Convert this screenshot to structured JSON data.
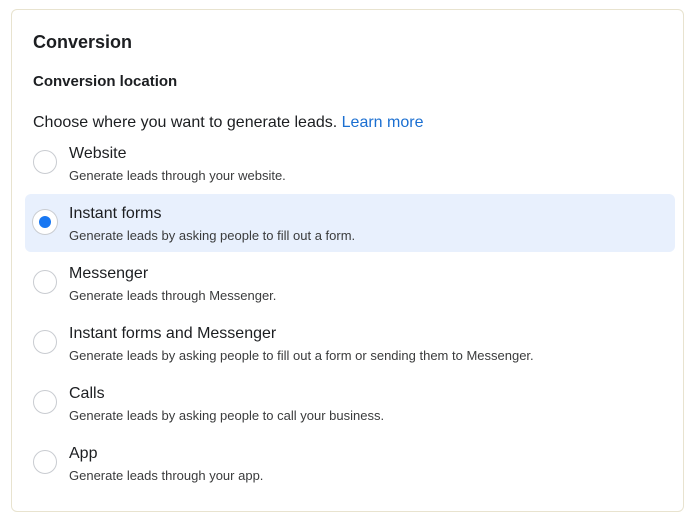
{
  "section": {
    "title": "Conversion"
  },
  "conversion_location": {
    "title": "Conversion location",
    "prompt": "Choose where you want to generate leads.",
    "learn_more": "Learn more",
    "selected_option": "Instant forms",
    "options": [
      {
        "label": "Website",
        "description": "Generate leads through your website."
      },
      {
        "label": "Instant forms",
        "description": "Generate leads by asking people to fill out a form."
      },
      {
        "label": "Messenger",
        "description": "Generate leads through Messenger."
      },
      {
        "label": "Instant forms and Messenger",
        "description": "Generate leads by asking people to fill out a form or sending them to Messenger."
      },
      {
        "label": "Calls",
        "description": "Generate leads by asking people to call your business."
      },
      {
        "label": "App",
        "description": "Generate leads through your app."
      }
    ]
  },
  "colors": {
    "accent": "#1877f2",
    "link": "#1b6fd1",
    "selected_background": "#e8f0fd",
    "card_border": "#e8e3cf"
  }
}
